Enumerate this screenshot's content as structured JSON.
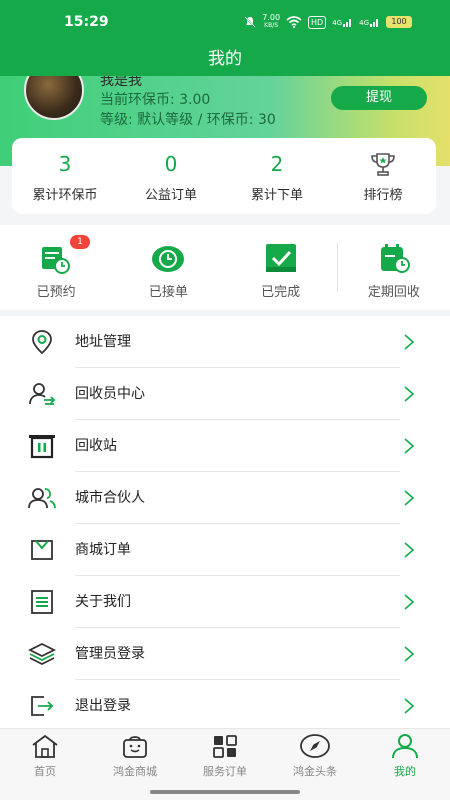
{
  "status": {
    "time": "15:29",
    "net_speed": "7.00",
    "net_unit": "KB/S",
    "hd": "HD",
    "sig1": "4G",
    "sig2": "4G",
    "battery": "100"
  },
  "header": {
    "title": "我的"
  },
  "profile": {
    "name": "我是我",
    "coin": "当前环保币: 3.00",
    "level": "等级: 默认等级 / 环保币: 30",
    "withdraw_label": "提现"
  },
  "stats": [
    {
      "value": "3",
      "label": "累计环保币"
    },
    {
      "value": "0",
      "label": "公益订单"
    },
    {
      "value": "2",
      "label": "累计下单"
    },
    {
      "label": "排行榜",
      "icon": "trophy-icon"
    }
  ],
  "orders": [
    {
      "label": "已预约",
      "badge": "1",
      "icon": "calendar-clock-icon"
    },
    {
      "label": "已接单",
      "icon": "clock-icon"
    },
    {
      "label": "已完成",
      "icon": "check-square-icon"
    },
    {
      "label": "定期回收",
      "icon": "recurring-calendar-icon"
    }
  ],
  "menu": [
    {
      "label": "地址管理",
      "icon": "location-pin-icon"
    },
    {
      "label": "回收员中心",
      "icon": "recycler-user-icon"
    },
    {
      "label": "回收站",
      "icon": "recycle-station-icon"
    },
    {
      "label": "城市合伙人",
      "icon": "partner-users-icon"
    },
    {
      "label": "商城订单",
      "icon": "mall-order-icon"
    },
    {
      "label": "关于我们",
      "icon": "about-document-icon"
    },
    {
      "label": "管理员登录",
      "icon": "admin-layers-icon"
    },
    {
      "label": "退出登录",
      "icon": "logout-icon"
    }
  ],
  "tabs": [
    {
      "label": "首页",
      "icon": "home-icon"
    },
    {
      "label": "鸿金商城",
      "icon": "shop-bag-icon"
    },
    {
      "label": "服务订单",
      "icon": "grid-apps-icon"
    },
    {
      "label": "鸿金头条",
      "icon": "compass-icon"
    },
    {
      "label": "我的",
      "icon": "profile-icon",
      "active": true
    }
  ],
  "colors": {
    "brand": "#16a94a",
    "badge": "#f0443a"
  }
}
